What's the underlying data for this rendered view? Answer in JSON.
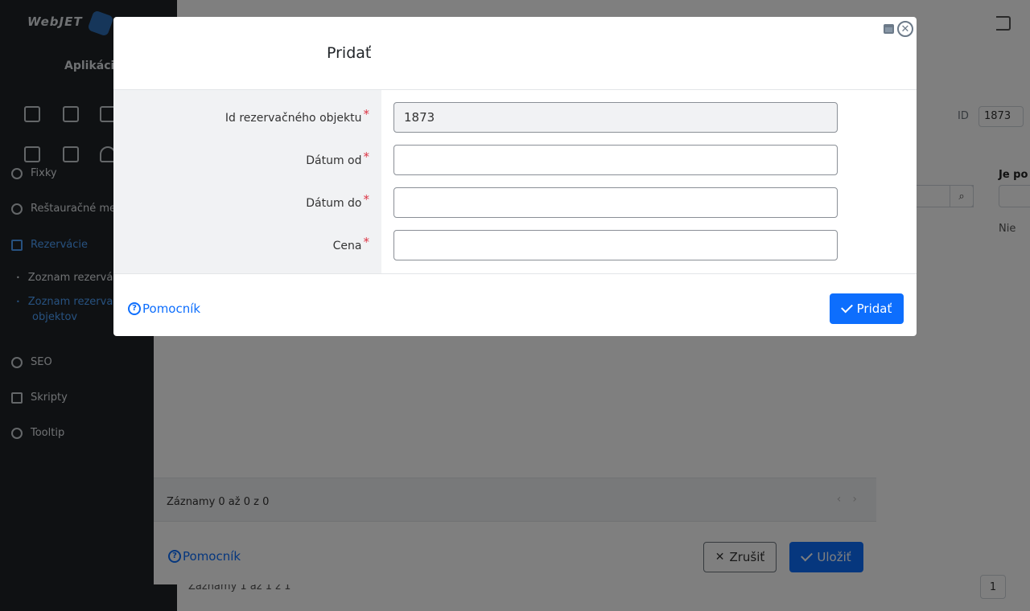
{
  "background": {
    "app_section": "Aplikácie",
    "sidebar_items": [
      {
        "label": "Fixky",
        "icon": "table-icon"
      },
      {
        "label": "Reštauračné me",
        "icon": "fork-knife-icon"
      },
      {
        "label": "Rezervácie",
        "icon": "calendar-icon",
        "active": true
      },
      {
        "label": "Zoznam rezervá",
        "icon": "dot-icon"
      },
      {
        "label": "Zoznam rezervač",
        "icon": "dot-icon",
        "active": true
      },
      {
        "label": "objektov",
        "icon": "",
        "active": true
      },
      {
        "label": "SEO",
        "icon": "search-icon"
      },
      {
        "label": "Skripty",
        "icon": "file-icon"
      },
      {
        "label": "Tooltip",
        "icon": "help-icon"
      }
    ],
    "id_label": "ID",
    "id_value": "1873",
    "column_header": "Je po",
    "cell_value": "Nie",
    "records_bottom": "Záznamy 1 až 1 z 1",
    "page_number": "1"
  },
  "middle_modal": {
    "records": "Záznamy 0 až 0 z 0",
    "help": "Pomocník",
    "cancel": "Zrušiť",
    "save": "Uložiť"
  },
  "modal": {
    "title": "Pridať",
    "fields": [
      {
        "label": "Id rezervačného objektu",
        "value": "1873",
        "readonly": true,
        "required": true
      },
      {
        "label": "Dátum od",
        "value": "",
        "required": true
      },
      {
        "label": "Dátum do",
        "value": "",
        "required": true
      },
      {
        "label": "Cena",
        "value": "",
        "required": true
      }
    ],
    "required_mark": "*",
    "help": "Pomocník",
    "help_icon_glyph": "?",
    "submit": "Pridať"
  }
}
